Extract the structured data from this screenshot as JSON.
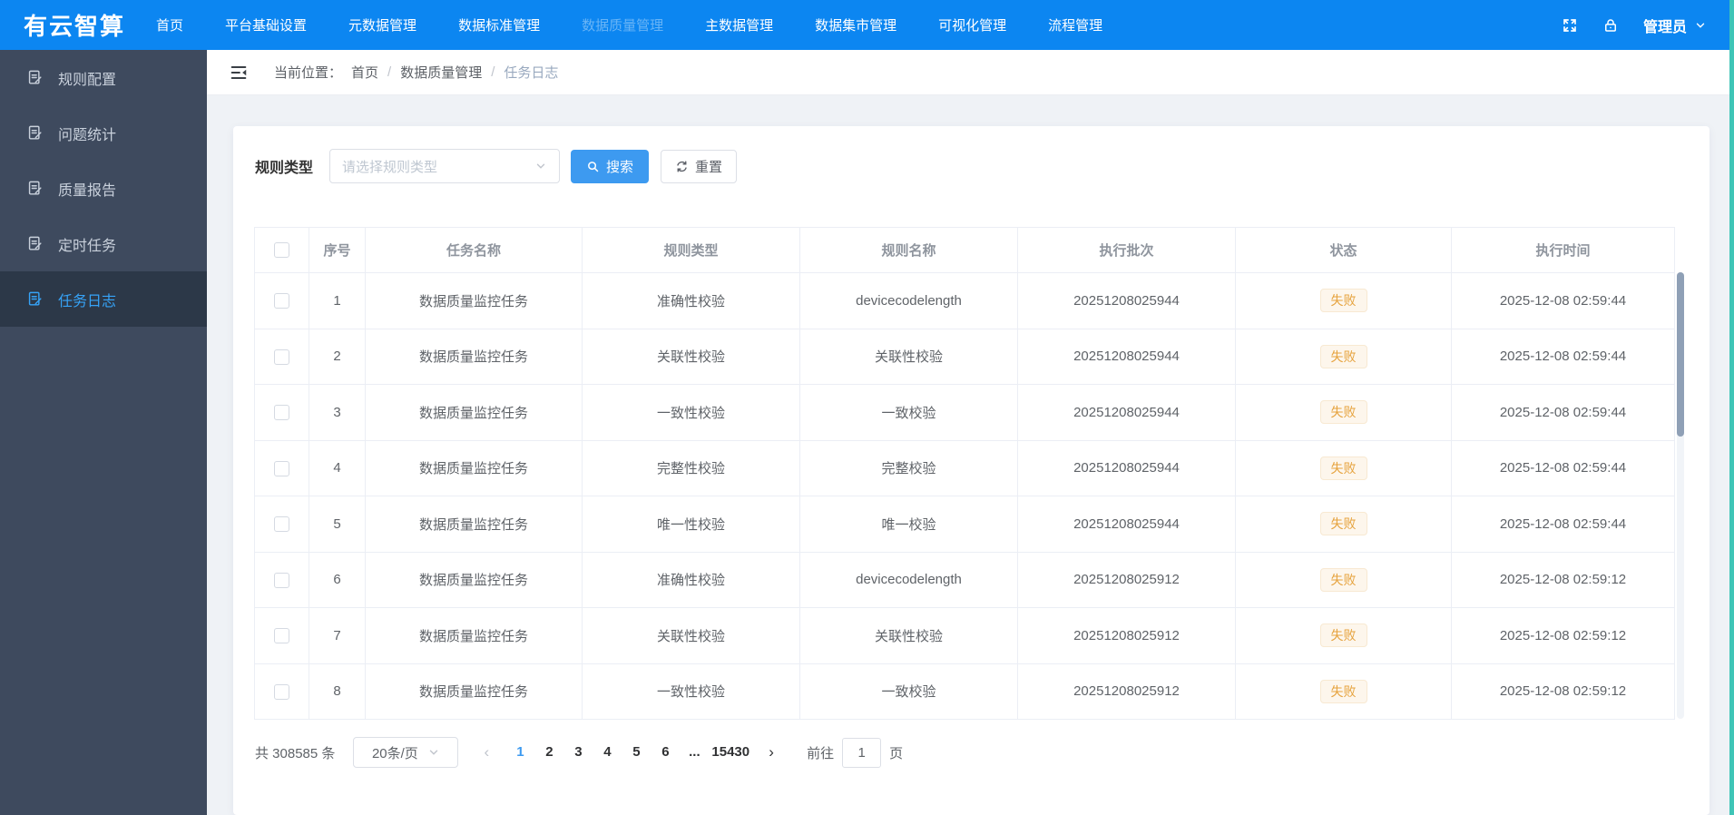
{
  "brand": "有云智算",
  "nav": {
    "items": [
      "首页",
      "平台基础设置",
      "元数据管理",
      "数据标准管理",
      "数据质量管理",
      "主数据管理",
      "数据集市管理",
      "可视化管理",
      "流程管理"
    ],
    "active": "数据质量管理",
    "user": "管理员"
  },
  "sidebar": {
    "items": [
      "规则配置",
      "问题统计",
      "质量报告",
      "定时任务",
      "任务日志"
    ],
    "active": "任务日志"
  },
  "breadcrumb": {
    "prefix": "当前位置：",
    "items": [
      "首页",
      "数据质量管理",
      "任务日志"
    ],
    "separator": "/"
  },
  "filter": {
    "label": "规则类型",
    "placeholder": "请选择规则类型",
    "search_label": "搜索",
    "reset_label": "重置"
  },
  "table": {
    "columns": [
      "序号",
      "任务名称",
      "规则类型",
      "规则名称",
      "执行批次",
      "状态",
      "执行时间"
    ],
    "rows": [
      {
        "index": "1",
        "task": "数据质量监控任务",
        "rule_type": "准确性校验",
        "rule_name": "devicecodelength",
        "batch": "20251208025944",
        "status": "失败",
        "time": "2025-12-08 02:59:44"
      },
      {
        "index": "2",
        "task": "数据质量监控任务",
        "rule_type": "关联性校验",
        "rule_name": "关联性校验",
        "batch": "20251208025944",
        "status": "失败",
        "time": "2025-12-08 02:59:44"
      },
      {
        "index": "3",
        "task": "数据质量监控任务",
        "rule_type": "一致性校验",
        "rule_name": "一致校验",
        "batch": "20251208025944",
        "status": "失败",
        "time": "2025-12-08 02:59:44"
      },
      {
        "index": "4",
        "task": "数据质量监控任务",
        "rule_type": "完整性校验",
        "rule_name": "完整校验",
        "batch": "20251208025944",
        "status": "失败",
        "time": "2025-12-08 02:59:44"
      },
      {
        "index": "5",
        "task": "数据质量监控任务",
        "rule_type": "唯一性校验",
        "rule_name": "唯一校验",
        "batch": "20251208025944",
        "status": "失败",
        "time": "2025-12-08 02:59:44"
      },
      {
        "index": "6",
        "task": "数据质量监控任务",
        "rule_type": "准确性校验",
        "rule_name": "devicecodelength",
        "batch": "20251208025912",
        "status": "失败",
        "time": "2025-12-08 02:59:12"
      },
      {
        "index": "7",
        "task": "数据质量监控任务",
        "rule_type": "关联性校验",
        "rule_name": "关联性校验",
        "batch": "20251208025912",
        "status": "失败",
        "time": "2025-12-08 02:59:12"
      },
      {
        "index": "8",
        "task": "数据质量监控任务",
        "rule_type": "一致性校验",
        "rule_name": "一致校验",
        "batch": "20251208025912",
        "status": "失败",
        "time": "2025-12-08 02:59:12"
      }
    ]
  },
  "pagination": {
    "total": "共 308585 条",
    "page_size": "20条/页",
    "pages": [
      "1",
      "2",
      "3",
      "4",
      "5",
      "6",
      "...",
      "15430"
    ],
    "active": "1",
    "goto_label": "前往",
    "goto_value": "1",
    "page_suffix": "页"
  },
  "colors": {
    "primary": "#0c86f1",
    "sidebar_bg": "#3e4a5e",
    "status_fail_text": "#e6a23c",
    "status_fail_bg": "#fdf6ec",
    "edge_accent": "#3fc5b7"
  }
}
